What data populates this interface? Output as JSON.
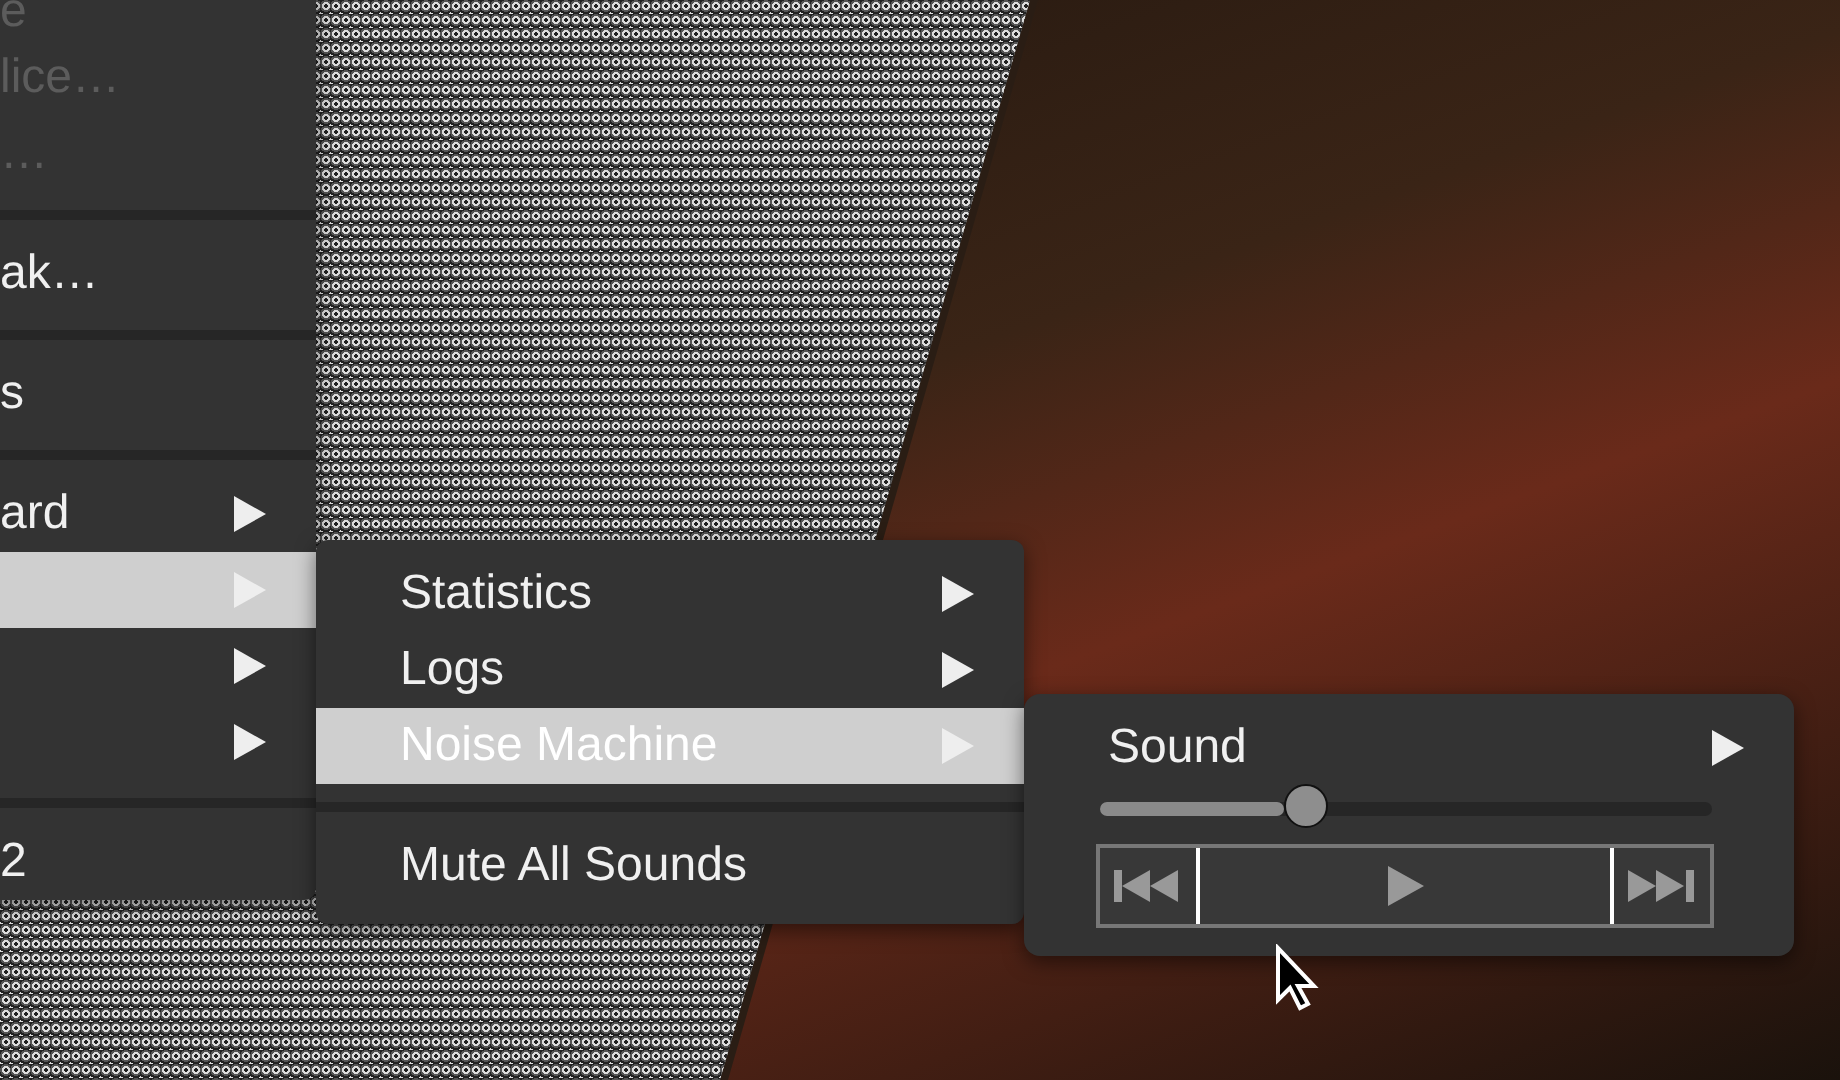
{
  "menus": [
    {
      "items": [
        {
          "kind": "item",
          "label": "e",
          "disabled": true,
          "selected": false,
          "submenu": false
        },
        {
          "kind": "item",
          "label": "lice…",
          "disabled": true,
          "selected": false,
          "submenu": false
        },
        {
          "kind": "item",
          "label": "…",
          "disabled": true,
          "selected": false,
          "submenu": false
        },
        {
          "kind": "separator"
        },
        {
          "kind": "item",
          "label": "ak…",
          "disabled": false,
          "selected": false,
          "submenu": false
        },
        {
          "kind": "separator"
        },
        {
          "kind": "item",
          "label": "s",
          "disabled": false,
          "selected": false,
          "submenu": false
        },
        {
          "kind": "separator"
        },
        {
          "kind": "item",
          "label": "ard",
          "disabled": false,
          "selected": false,
          "submenu": true
        },
        {
          "kind": "item",
          "disabled": false,
          "selected": true,
          "submenu": true
        },
        {
          "kind": "item",
          "disabled": false,
          "selected": false,
          "submenu": true
        },
        {
          "kind": "item",
          "disabled": false,
          "selected": false,
          "submenu": true
        },
        {
          "kind": "separator"
        },
        {
          "kind": "item",
          "label": "2",
          "disabled": false,
          "selected": false,
          "submenu": false
        }
      ]
    },
    {
      "items": [
        {
          "kind": "item",
          "label": "Statistics",
          "disabled": false,
          "selected": false,
          "submenu": true
        },
        {
          "kind": "item",
          "label": "Logs",
          "disabled": false,
          "selected": false,
          "submenu": true
        },
        {
          "kind": "item",
          "label": "Noise Machine",
          "disabled": false,
          "selected": true,
          "submenu": true
        },
        {
          "kind": "separator"
        },
        {
          "kind": "item",
          "label": "Mute All Sounds",
          "disabled": false,
          "selected": false,
          "submenu": false
        }
      ]
    },
    {
      "items": [
        {
          "kind": "item",
          "label": "Sound",
          "disabled": false,
          "selected": false,
          "submenu": true
        },
        {
          "kind": "slider",
          "level": 0.34
        },
        {
          "kind": "transport"
        }
      ]
    }
  ]
}
